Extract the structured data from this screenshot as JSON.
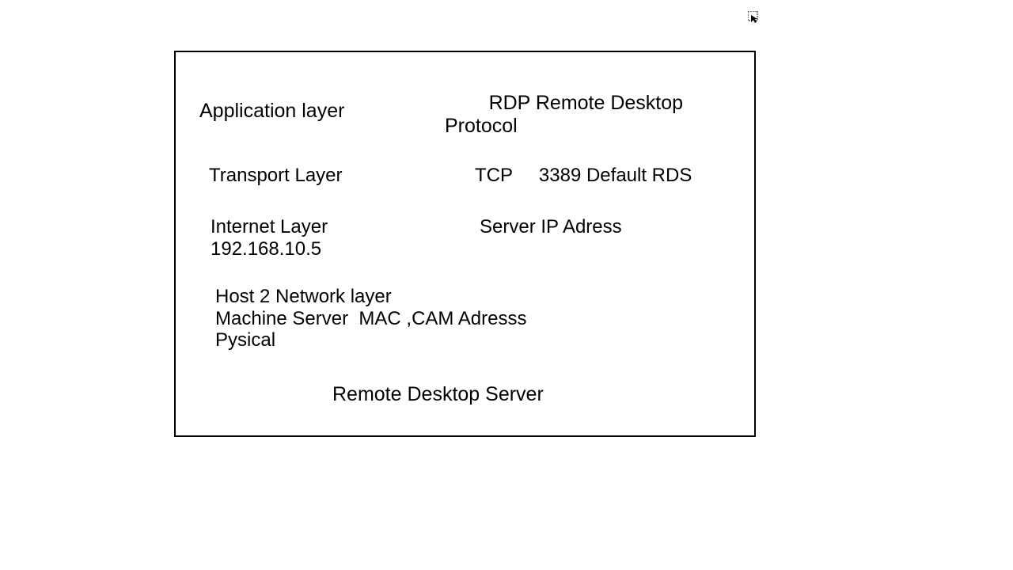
{
  "diagram": {
    "layers": {
      "application": {
        "left_label": "Application layer",
        "right_label": "        RDP Remote Desktop Protocol"
      },
      "transport": {
        "left_label": "Transport Layer",
        "right_label": "TCP     3389 Default RDS"
      },
      "internet": {
        "left_label": "Internet Layer",
        "right_label": "Server IP Adress",
        "ip": "192.168.10.5"
      },
      "host2network": {
        "text": "Host 2 Network layer\nMachine Server  MAC ,CAM Adresss Pysical"
      }
    },
    "footer": "Remote Desktop Server"
  },
  "cursor": "cursor-select-icon"
}
